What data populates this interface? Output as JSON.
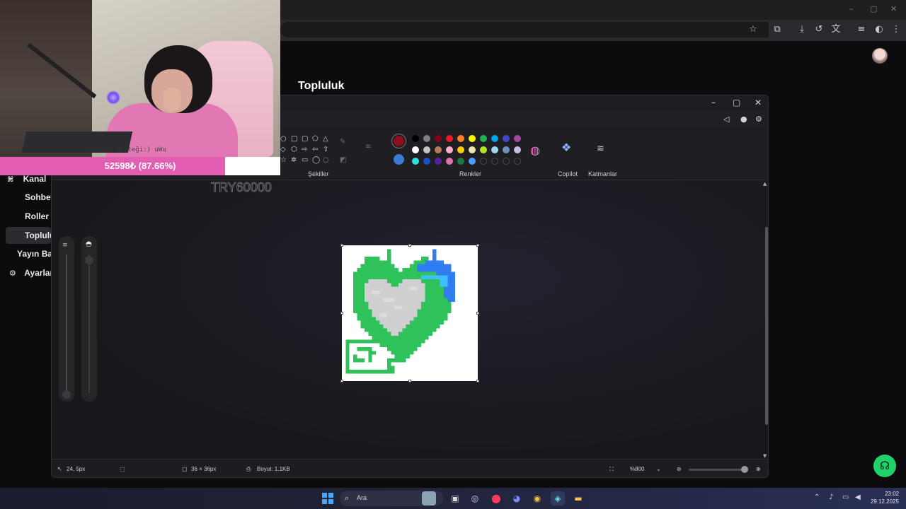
{
  "community": {
    "page_title": "Topluluk",
    "sidebar": [
      {
        "label": "Kanal",
        "icon": "channel-icon"
      },
      {
        "label": "Sohbet"
      },
      {
        "label": "Roller"
      },
      {
        "label": "Topluluk",
        "active": true
      },
      {
        "label": "Yayın Bağ"
      },
      {
        "label": "Ayarlar",
        "icon": "gear-icon"
      }
    ]
  },
  "stream_overlay": {
    "cam_caption": "s̶e̶lenen desteği:) uWu",
    "goal_text": "52598₺ (87.66%)",
    "goal_progress": 87.66,
    "goal_target": "TRY60000"
  },
  "paint": {
    "groups": {
      "shapes": "Şekiller",
      "colors": "Renkler",
      "copilot": "Copilot",
      "layers": "Katmanlar"
    },
    "primary_color": "#8b0f1c",
    "secondary_color": "#3a7bd5",
    "palette_row1": [
      "#000000",
      "#7f7f7f",
      "#880015",
      "#ed1c24",
      "#ff7f27",
      "#fff200",
      "#22b14c",
      "#00a2e8",
      "#3f48cc",
      "#a349a4"
    ],
    "palette_row2": [
      "#ffffff",
      "#c3c3c3",
      "#b97a57",
      "#ffaec9",
      "#ffc90e",
      "#efe4b0",
      "#b5e61d",
      "#99d9ea",
      "#7092be",
      "#c8bfe7"
    ],
    "palette_row3": [
      "#2fe0e0",
      "#1a4fc4",
      "#5a1fa0",
      "#e36fb0",
      "#1e7a3c",
      "#4aa0ff",
      "",
      "",
      "",
      ""
    ],
    "status": {
      "cursor": "24, 5px",
      "canvas_size": "36 × 36px",
      "file_size": "Boyut: 1.1KB",
      "zoom": "%800"
    }
  },
  "help_icon": "headset-icon",
  "taskbar": {
    "search_placeholder": "Ara",
    "time": "23:02",
    "date": "29.12.2025"
  }
}
